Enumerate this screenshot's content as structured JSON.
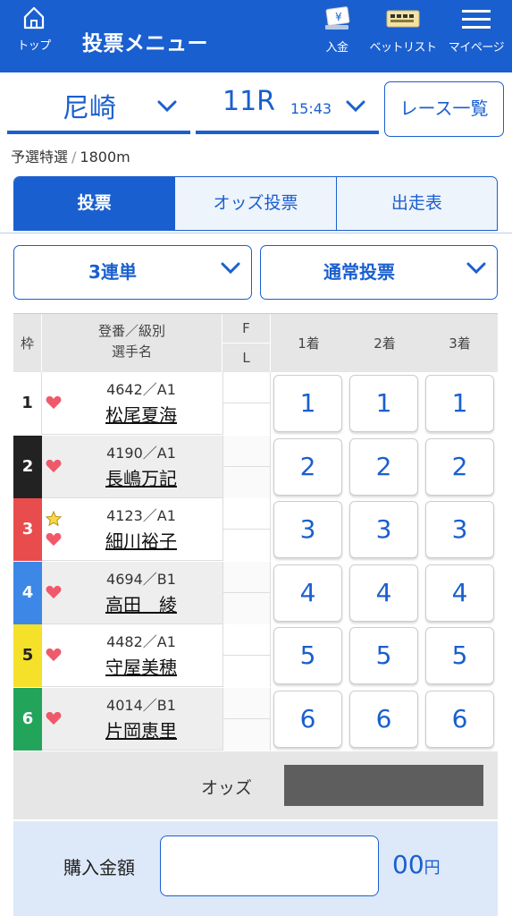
{
  "header": {
    "home_label": "トップ",
    "title": "投票メニュー",
    "deposit_label": "入金",
    "betlist_label": "ベットリスト",
    "mypage_label": "マイページ",
    "accent_color": "#1a5fcf"
  },
  "race_select": {
    "venue": "尼崎",
    "race": "11R",
    "time": "15:43",
    "race_list_button": "レース一覧"
  },
  "race_info": {
    "grade": "予選特選",
    "separator": "/",
    "distance": "1800m"
  },
  "tabs": [
    {
      "label": "投票",
      "active": true
    },
    {
      "label": "オッズ投票",
      "active": false
    },
    {
      "label": "出走表",
      "active": false
    }
  ],
  "bet_type": {
    "selected": "3連単"
  },
  "bet_method": {
    "selected": "通常投票"
  },
  "table": {
    "headers": {
      "waku": "枠",
      "name_top": "登番／級別",
      "name_bottom": "選手名",
      "f": "F",
      "l": "L",
      "rank1": "1着",
      "rank2": "2着",
      "rank3": "3着"
    },
    "rows": [
      {
        "waku": "1",
        "reg": "4642／A1",
        "name": "松尾夏海",
        "color": "#ffffff",
        "text_color": "#222222",
        "star": false
      },
      {
        "waku": "2",
        "reg": "4190／A1",
        "name": "長嶋万記",
        "color": "#222222",
        "text_color": "#ffffff",
        "star": false
      },
      {
        "waku": "3",
        "reg": "4123／A1",
        "name": "細川裕子",
        "color": "#e84c4c",
        "text_color": "#ffffff",
        "star": true
      },
      {
        "waku": "4",
        "reg": "4694／B1",
        "name": "高田　綾",
        "color": "#3d87e6",
        "text_color": "#ffffff",
        "star": false
      },
      {
        "waku": "5",
        "reg": "4482／A1",
        "name": "守屋美穂",
        "color": "#f5e02a",
        "text_color": "#222222",
        "star": false
      },
      {
        "waku": "6",
        "reg": "4014／B1",
        "name": "片岡恵里",
        "color": "#22a45a",
        "text_color": "#ffffff",
        "star": false
      }
    ]
  },
  "odds": {
    "label": "オッズ"
  },
  "amount": {
    "label": "購入金額",
    "value": "",
    "placeholder": "",
    "unit_suffix": "00",
    "unit_yen": "円"
  }
}
